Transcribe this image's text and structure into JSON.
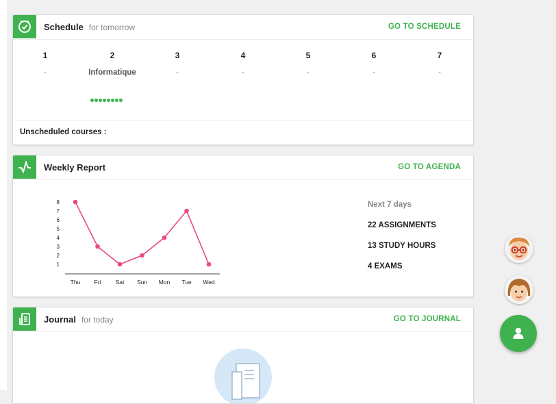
{
  "schedule": {
    "title": "Schedule",
    "subtitle": "for tomorrow",
    "link": "GO TO SCHEDULE",
    "periods": [
      {
        "num": "1",
        "subject": "-"
      },
      {
        "num": "2",
        "subject": "Informatique"
      },
      {
        "num": "3",
        "subject": "-"
      },
      {
        "num": "4",
        "subject": "-"
      },
      {
        "num": "5",
        "subject": "-"
      },
      {
        "num": "6",
        "subject": "-"
      },
      {
        "num": "7",
        "subject": "-"
      }
    ],
    "unscheduled_label": "Unscheduled courses :"
  },
  "weekly": {
    "title": "Weekly Report",
    "link": "GO TO AGENDA",
    "stats_head": "Next 7 days",
    "assignments": "22 ASSIGNMENTS",
    "study_hours": "13 STUDY HOURS",
    "exams": "4 EXAMS"
  },
  "journal": {
    "title": "Journal",
    "subtitle": "for today",
    "link": "GO TO JOURNAL"
  },
  "colors": {
    "accent": "#3fb24f",
    "line": "#e94b7d"
  },
  "icons": {
    "schedule": "clock-icon",
    "weekly": "pulse-icon",
    "journal": "journal-icon",
    "fab": "user-icon"
  },
  "chart_data": {
    "type": "line",
    "categories": [
      "Thu",
      "Fri",
      "Sat",
      "Sun",
      "Mon",
      "Tue",
      "Wed"
    ],
    "values": [
      8,
      3,
      1,
      2,
      4,
      7,
      1
    ],
    "yticks": [
      "1",
      "2",
      "3",
      "4",
      "5",
      "6",
      "7",
      "8"
    ],
    "ylim": [
      0,
      8
    ],
    "grid": false
  }
}
